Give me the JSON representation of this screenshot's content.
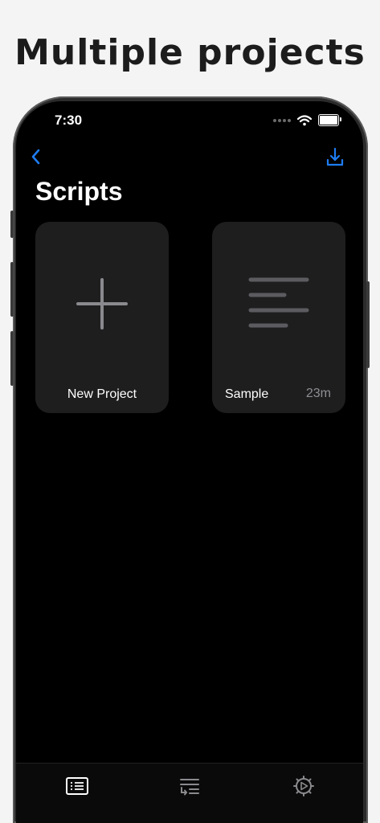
{
  "headline": "Multiple projects",
  "status_bar": {
    "time": "7:30"
  },
  "nav": {
    "back_icon": "chevron-left-icon",
    "download_icon": "download-icon"
  },
  "screen": {
    "title": "Scripts"
  },
  "projects": [
    {
      "label": "New Project",
      "icon": "plus-icon",
      "meta": ""
    },
    {
      "label": "Sample",
      "icon": "document-lines-icon",
      "meta": "23m"
    }
  ],
  "tab_bar": {
    "tabs": [
      {
        "icon": "script-list-icon",
        "selected": true
      },
      {
        "icon": "reorder-list-icon",
        "selected": false
      },
      {
        "icon": "gear-play-icon",
        "selected": false
      }
    ]
  },
  "colors": {
    "accent": "#1e7cf2",
    "background": "#000000",
    "card": "#1e1e1f",
    "secondary_text": "#8e8e93"
  }
}
